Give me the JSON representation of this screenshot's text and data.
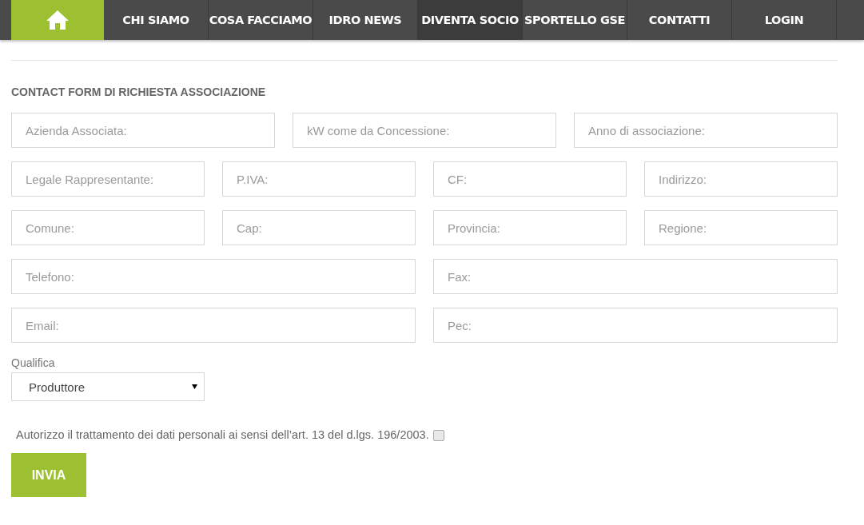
{
  "nav": {
    "items": [
      {
        "label": "CHI SIAMO",
        "selected": false
      },
      {
        "label": "COSA FACCIAMO",
        "selected": false
      },
      {
        "label": "IDRO NEWS",
        "selected": false
      },
      {
        "label": "DIVENTA SOCIO",
        "selected": true
      },
      {
        "label": "SPORTELLO GSE",
        "selected": false
      },
      {
        "label": "CONTATTI",
        "selected": false
      },
      {
        "label": "LOGIN",
        "selected": false
      }
    ]
  },
  "form": {
    "title": "CONTACT FORM DI RICHIESTA ASSOCIAZIONE",
    "rows": [
      {
        "fields": [
          {
            "placeholder": "Azienda Associata:"
          },
          {
            "placeholder": "kW come da Concessione:"
          },
          {
            "placeholder": "Anno di associazione:"
          }
        ]
      },
      {
        "fields": [
          {
            "placeholder": "Legale Rappresentante:"
          },
          {
            "placeholder": "P.IVA:"
          },
          {
            "placeholder": "CF:"
          },
          {
            "placeholder": "Indirizzo:"
          }
        ]
      },
      {
        "fields": [
          {
            "placeholder": "Comune:"
          },
          {
            "placeholder": "Cap:"
          },
          {
            "placeholder": "Provincia:"
          },
          {
            "placeholder": "Regione:"
          }
        ]
      },
      {
        "fields": [
          {
            "placeholder": "Telefono:"
          },
          {
            "placeholder": "Fax:"
          }
        ]
      },
      {
        "fields": [
          {
            "placeholder": "Email:"
          },
          {
            "placeholder": "Pec:"
          }
        ]
      }
    ],
    "qualifica": {
      "label": "Qualifica",
      "value": "Produttore"
    },
    "consent": {
      "text": "Autorizzo il trattamento dei dati personali ai sensi dell’art. 13 del d.lgs. 196/2003.",
      "checked": false
    },
    "submit": "INVIA"
  }
}
